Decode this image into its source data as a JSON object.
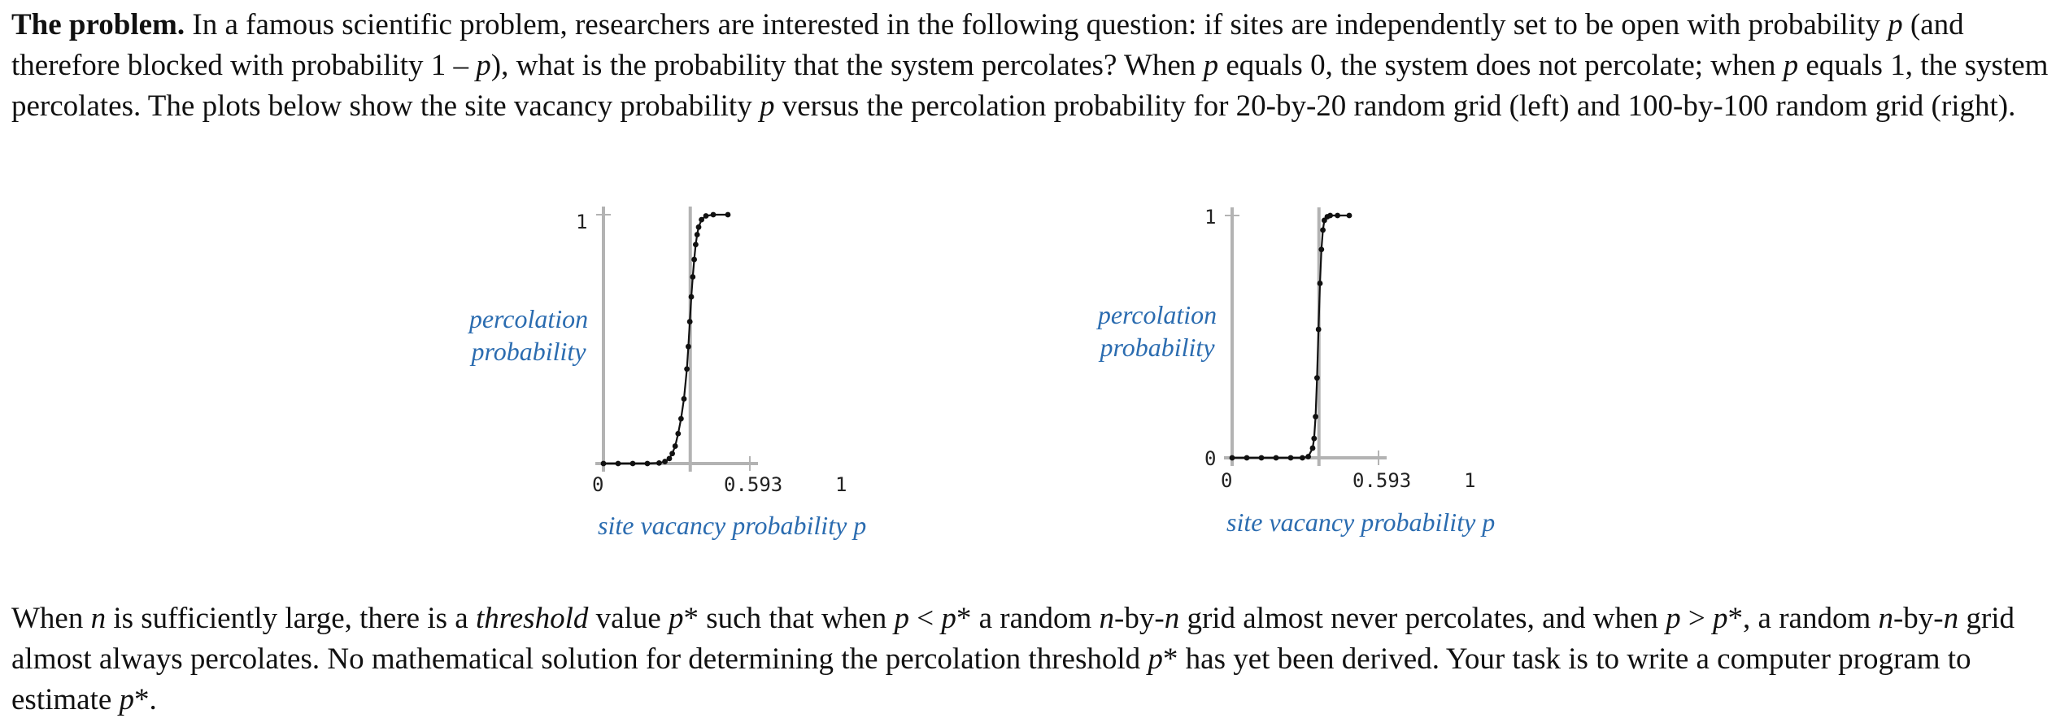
{
  "intro": {
    "heading": "The problem.",
    "body": [
      {
        "t": " In a famous scientific problem, researchers are interested in the following question: if sites are independently set to be open with probability "
      },
      {
        "t": "p",
        "i": true
      },
      {
        "t": " (and therefore blocked with probability 1 – "
      },
      {
        "t": "p",
        "i": true
      },
      {
        "t": "), what is the probability that the system percolates? When "
      },
      {
        "t": "p",
        "i": true
      },
      {
        "t": " equals 0, the system does not percolate; when "
      },
      {
        "t": "p",
        "i": true
      },
      {
        "t": " equals 1, the system percolates. The plots below show the site vacancy probability "
      },
      {
        "t": "p",
        "i": true
      },
      {
        "t": " versus the percolation probability for 20-by-20 random grid (left) and 100-by-100 random grid (right)."
      }
    ]
  },
  "outro": {
    "body": [
      {
        "t": "When "
      },
      {
        "t": "n",
        "i": true
      },
      {
        "t": " is sufficiently large, there is a "
      },
      {
        "t": "threshold",
        "i": true
      },
      {
        "t": " value "
      },
      {
        "t": "p",
        "i": true
      },
      {
        "t": "* such that when "
      },
      {
        "t": "p",
        "i": true
      },
      {
        "t": " < "
      },
      {
        "t": "p",
        "i": true
      },
      {
        "t": "* a random "
      },
      {
        "t": "n",
        "i": true
      },
      {
        "t": "-by-"
      },
      {
        "t": "n",
        "i": true
      },
      {
        "t": " grid almost never percolates, and when "
      },
      {
        "t": "p",
        "i": true
      },
      {
        "t": " > "
      },
      {
        "t": "p",
        "i": true
      },
      {
        "t": "*, a random "
      },
      {
        "t": "n",
        "i": true
      },
      {
        "t": "-by-"
      },
      {
        "t": "n",
        "i": true
      },
      {
        "t": " grid almost always percolates. No mathematical solution for determining the percolation threshold "
      },
      {
        "t": "p",
        "i": true
      },
      {
        "t": "* has yet been derived. Your task is to write a computer program to estimate "
      },
      {
        "t": "p",
        "i": true
      },
      {
        "t": "*."
      }
    ]
  },
  "colors": {
    "label": "#2b6cb0",
    "axis": "#b3b3b3",
    "curve": "#111111"
  },
  "chart_data": [
    {
      "type": "line",
      "title": "",
      "xlabel": "site vacancy probability p",
      "ylabel": "percolation probability",
      "xlim": [
        0,
        1
      ],
      "ylim": [
        0,
        1
      ],
      "x_ticks": [
        "0",
        "0.593",
        "1"
      ],
      "y_ticks": [
        "1"
      ],
      "threshold": 0.593,
      "grid": false,
      "series": [
        {
          "x": [
            0.0,
            0.1,
            0.2,
            0.3,
            0.38,
            0.42,
            0.45,
            0.47,
            0.49,
            0.51,
            0.53,
            0.55,
            0.57,
            0.58,
            0.59,
            0.6,
            0.61,
            0.62,
            0.63,
            0.64,
            0.65,
            0.67,
            0.7,
            0.75,
            0.85
          ],
          "y": [
            0.0,
            0.0,
            0.0,
            0.0,
            0.002,
            0.008,
            0.02,
            0.04,
            0.07,
            0.12,
            0.18,
            0.26,
            0.38,
            0.47,
            0.57,
            0.67,
            0.75,
            0.82,
            0.88,
            0.92,
            0.95,
            0.98,
            0.995,
            1.0,
            1.0
          ]
        }
      ]
    },
    {
      "type": "line",
      "title": "",
      "xlabel": "site vacancy probability p",
      "ylabel": "percolation probability",
      "xlim": [
        0,
        1
      ],
      "ylim": [
        0,
        1
      ],
      "x_ticks": [
        "0",
        "0.593",
        "1"
      ],
      "y_ticks": [
        "0",
        "1"
      ],
      "threshold": 0.593,
      "grid": false,
      "series": [
        {
          "x": [
            0.0,
            0.1,
            0.2,
            0.3,
            0.4,
            0.48,
            0.52,
            0.55,
            0.56,
            0.57,
            0.58,
            0.59,
            0.6,
            0.61,
            0.62,
            0.63,
            0.65,
            0.67,
            0.72,
            0.8
          ],
          "y": [
            0.0,
            0.0,
            0.0,
            0.0,
            0.0,
            0.0,
            0.005,
            0.04,
            0.08,
            0.17,
            0.33,
            0.53,
            0.72,
            0.86,
            0.94,
            0.98,
            0.995,
            1.0,
            1.0,
            1.0
          ]
        }
      ]
    }
  ]
}
